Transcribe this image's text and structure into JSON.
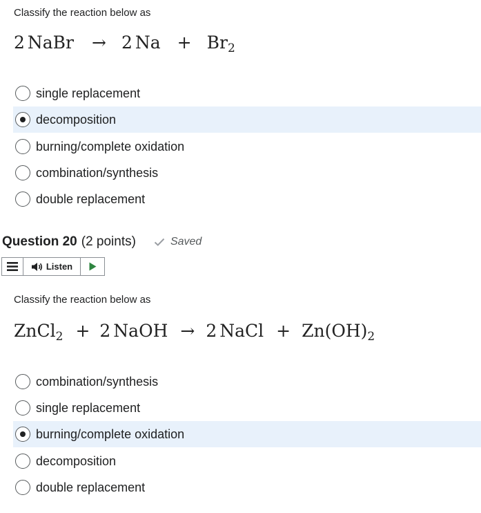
{
  "question1": {
    "prompt": "Classify the reaction below as",
    "equation": {
      "reactant1_coef": "2",
      "reactant1": "NaBr",
      "arrow": "→",
      "product1_coef": "2",
      "product1": "Na",
      "plus": "+",
      "product2": "Br",
      "product2_sub": "2"
    },
    "options": [
      {
        "label": "single replacement",
        "selected": false
      },
      {
        "label": "decomposition",
        "selected": true
      },
      {
        "label": "burning/complete oxidation",
        "selected": false
      },
      {
        "label": "combination/synthesis",
        "selected": false
      },
      {
        "label": "double replacement",
        "selected": false
      }
    ]
  },
  "question2": {
    "title": "Question 20",
    "points": "(2 points)",
    "saved_label": "Saved",
    "listen_bar": {
      "menu_icon": "hamburger-icon",
      "listen_label": "Listen",
      "speaker_icon": "speaker-icon",
      "play_icon": "play-icon"
    },
    "prompt": "Classify the reaction below as",
    "equation": {
      "reactant1": "ZnCl",
      "reactant1_sub": "2",
      "plus1": "+",
      "reactant2_coef": "2",
      "reactant2": "NaOH",
      "arrow": "→",
      "product1_coef": "2",
      "product1": "NaCl",
      "plus2": "+",
      "product2": "Zn(OH)",
      "product2_sub": "2"
    },
    "options": [
      {
        "label": "combination/synthesis",
        "selected": false
      },
      {
        "label": "single replacement",
        "selected": false
      },
      {
        "label": "burning/complete oxidation",
        "selected": true
      },
      {
        "label": "decomposition",
        "selected": false
      },
      {
        "label": "double replacement",
        "selected": false
      }
    ]
  },
  "colors": {
    "selected_background": "#e8f1fb",
    "play_green": "#2e8540",
    "text": "#202122",
    "muted": "#565a5c"
  }
}
